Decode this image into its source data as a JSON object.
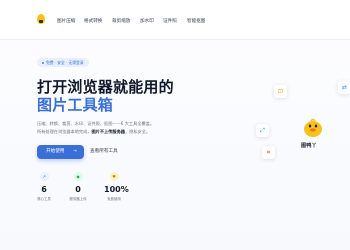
{
  "nav": {
    "items": [
      "图片压缩",
      "格式转换",
      "裁剪缩放",
      "加水印",
      "证件照",
      "智能抠图"
    ]
  },
  "hero": {
    "tag": "免费 · 安全 · 无需登录",
    "title_line1": "打开浏览器就能用的",
    "title_line2": "图片工具箱",
    "desc_line1": "压缩、转换、裁剪、水印、证件照、抠图——6 大工具全覆盖。",
    "desc_line2_pre": "所有处理在浏览器本地完成，",
    "desc_line2_bold": "图片不上传服务器",
    "desc_line2_post": "，隐私安全。",
    "primary_button": "开始使用",
    "primary_arrow": "→",
    "secondary_button": "查看所有工具"
  },
  "stats": [
    {
      "icon": "lightning-icon",
      "icon_glyph": "↗",
      "value": "6",
      "label": "核心工具",
      "color": "#3b6fd8",
      "bg": "#e8f0fe"
    },
    {
      "icon": "shield-icon",
      "icon_glyph": "◆",
      "value": "0",
      "label": "服务器上传",
      "color": "#16a34a",
      "bg": "#dcfce7"
    },
    {
      "icon": "gift-icon",
      "icon_glyph": "♥",
      "value": "100%",
      "label": "免费使用",
      "color": "#d97706",
      "bg": "#fef3c7"
    }
  ],
  "floating": [
    {
      "icon": "compress-icon",
      "glyph": "⊡",
      "color": "#f59e0b"
    },
    {
      "icon": "convert-icon",
      "glyph": "⇄",
      "color": "#3b82f6"
    },
    {
      "icon": "resize-icon",
      "glyph": "⤢",
      "color": "#10b981"
    },
    {
      "icon": "crop-icon",
      "glyph": "⌗",
      "color": "#ef4444"
    }
  ],
  "mascot": {
    "label": "图鸭丫",
    "color": "#f8c21c"
  },
  "colors": {
    "accent": "#3b6fd8",
    "text": "#0f172a",
    "muted": "#6b7280"
  }
}
